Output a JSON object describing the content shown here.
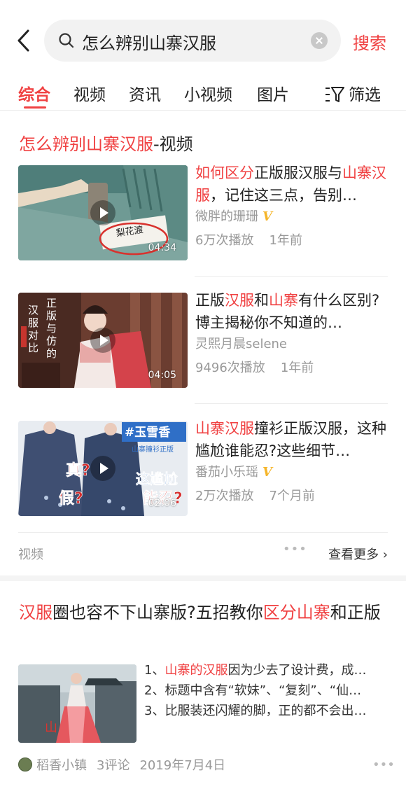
{
  "header": {
    "query": "怎么辨别山寨汉服",
    "search_label": "搜索"
  },
  "tabs": [
    "综合",
    "视频",
    "资讯",
    "小视频",
    "图片"
  ],
  "filter_label": "筛选",
  "video_section": {
    "title_hl": "怎么辨别山寨汉服",
    "title_rest": "-视频",
    "videos": [
      {
        "title_parts": [
          {
            "t": "如何区分",
            "hl": true
          },
          {
            "t": "正版服汉服与",
            "hl": false
          },
          {
            "t": "山寨",
            "hl": true
          },
          {
            "t": "汉服",
            "hl": true
          },
          {
            "t": "，记住这三点，告别…",
            "hl": false
          }
        ],
        "author": "微胖的珊珊",
        "badge": "V",
        "plays": "6万次播放",
        "age": "1年前",
        "duration": "04:34"
      },
      {
        "title_parts": [
          {
            "t": "正版",
            "hl": false
          },
          {
            "t": "汉服",
            "hl": true
          },
          {
            "t": "和",
            "hl": false
          },
          {
            "t": "山寨",
            "hl": true
          },
          {
            "t": "有什么区别?博主揭秘你不知道的…",
            "hl": false
          }
        ],
        "author": "灵熙月晨selene",
        "badge": "",
        "plays": "9496次播放",
        "age": "1年前",
        "duration": "04:05"
      },
      {
        "title_parts": [
          {
            "t": "山寨汉服",
            "hl": true
          },
          {
            "t": "撞衫正版汉服，这种尴尬谁能忍?这些细节…",
            "hl": false
          }
        ],
        "author": "番茄小乐瑶",
        "badge": "V",
        "plays": "2万次播放",
        "age": "7个月前",
        "duration": "02:06"
      }
    ],
    "footer_label": "视频",
    "more_label": "查看更多",
    "thumb_texts": {
      "v1_label": "梨花渡",
      "v2_vertical_1": "正版与仿的",
      "v2_vertical_2": "汉服对比",
      "v3_tag": "#玉雪香",
      "v3_sub": "山寨撞衫正版",
      "v3_q1": "真?",
      "v3_q2": "假?",
      "v3_mid": "这尴尬",
      "v3_end": "能忍?"
    }
  },
  "article": {
    "title_parts": [
      {
        "t": "汉服",
        "hl": true
      },
      {
        "t": "圈也容不下山寨版?五招教你",
        "hl": false
      },
      {
        "t": "区分山寨",
        "hl": true
      },
      {
        "t": "和正版",
        "hl": false
      }
    ],
    "lines": [
      [
        {
          "t": "1、",
          "hl": false
        },
        {
          "t": "山寨的汉服",
          "hl": true
        },
        {
          "t": "因为少去了设计费，成…",
          "hl": false
        }
      ],
      [
        {
          "t": "2、标题中含有“软妹”、“复刻”、“仙…",
          "hl": false
        }
      ],
      [
        {
          "t": "3、比服装还闪耀的脚，正的都不会出…",
          "hl": false
        }
      ]
    ],
    "author": "稻香小镇",
    "comments": "3评论",
    "date": "2019年7月4日"
  },
  "colors": {
    "accent": "#f04142",
    "muted": "#999999"
  }
}
